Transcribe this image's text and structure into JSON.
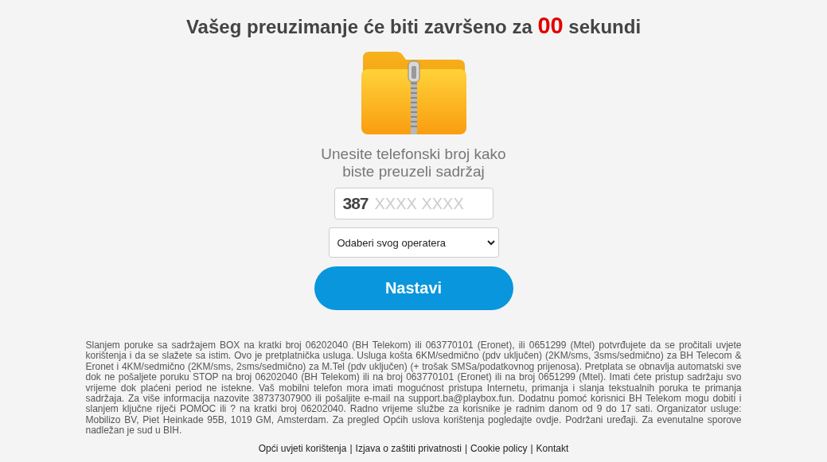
{
  "heading": {
    "before": "Vašeg preuzimanje će biti završeno za",
    "countdown": "00",
    "after": "sekundi"
  },
  "prompt": "Unesite telefonski broj kako biste preuzeli sadržaj",
  "phone": {
    "prefix": "387",
    "placeholder": "XXXX XXXX"
  },
  "operator_select": {
    "value": "Odaberi svog operatera"
  },
  "button": "Nastavi",
  "terms": "Slanjem poruke sa sadržajem BOX na kratki broj 06202040 (BH Telekom) ili 063770101 (Eronet), ili 0651299 (Mtel) potvrđujete da se pročitali uvjete korištenja i da se slažete sa istim. Ovo je pretplatnička usluga. Usluga košta 6KM/sedmično (pdv uključen) (2KM/sms, 3sms/sedmično) za BH Telecom & Eronet i 4KM/sedmično (2KM/sms, 2sms/sedmično) za M.Tel (pdv uključen) (+ trošak SMSa/podatkovnog prijenosa). Pretplata se obnavlja automatski sve dok ne pošaljete poruku STOP na broj 06202040 (BH Telekom) ili na broj 063770101 (Eronet) ili na broj 0651299 (Mtel). Imati ćete pristup sadržaju svo vrijeme dok plaćeni period ne istekne. Vaš mobilni telefon mora imati mogućnost pristupa Internetu, primanja i slanja tekstualnih poruka te primanja sadržaja. Za više informacija nazovite 38737307900 ili pošaljite e-mail na support.ba@playbox.fun. Dodatnu pomoć korisnici BH Telekom mogu dobiti i slanjem ključne riječi POMOC ili ? na kratki broj 06202040. Radno vrijeme službe za korisnike je radnim danom od 9 do 17 sati. Organizator usluge: Mobilizo BV, Piet Heinkade 95B, 1019 GM, Amsterdam. Za pregled Općih uslova korištenja pogledajte ovdje. Podržani uređaji. Za evenutalne sporove nadležan je sud u BIH.",
  "footer_links": [
    "Opći uvjeti korištenja",
    "Izjava o zaštiti privatnosti",
    "Cookie policy",
    "Kontakt"
  ],
  "footer_separator": "|"
}
